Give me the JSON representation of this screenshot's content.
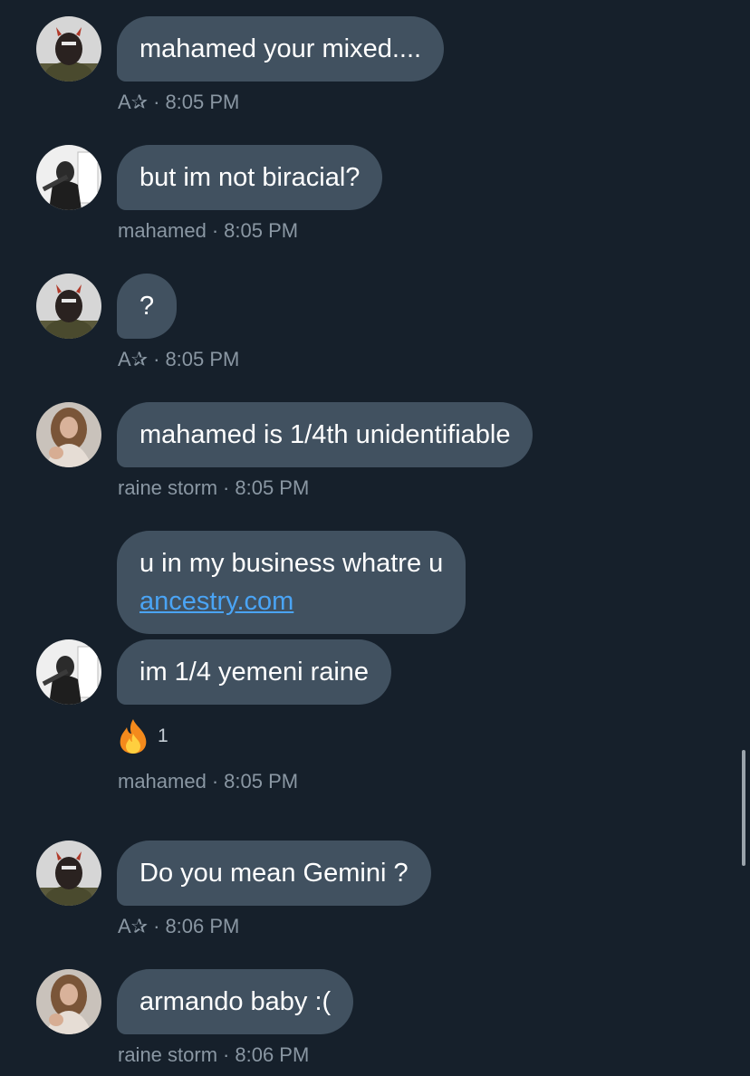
{
  "colors": {
    "background": "#16202b",
    "bubble": "#415160",
    "meta_text": "#8a97a3",
    "link": "#4aa4f5"
  },
  "messages": [
    {
      "author": "A✰",
      "time": "8:05 PM",
      "text": "mahamed your mixed....",
      "avatar": "avatar-a"
    },
    {
      "author": "mahamed",
      "time": "8:05 PM",
      "text": "but im not biracial?",
      "avatar": "avatar-mahamed"
    },
    {
      "author": "A✰",
      "time": "8:05 PM",
      "text": "?",
      "avatar": "avatar-a"
    },
    {
      "author": "raine storm",
      "time": "8:05 PM",
      "text": "mahamed is 1/4th unidentifiable",
      "avatar": "avatar-raine"
    },
    {
      "author": "mahamed",
      "time": "8:05 PM",
      "avatar": "avatar-mahamed",
      "bubbles": [
        {
          "text_line1": "u in my business whatre u",
          "link": "ancestry.com"
        },
        {
          "text": "im 1/4 yemeni raine"
        }
      ],
      "reaction": {
        "icon": "fire-emoji-icon",
        "count": "1"
      }
    },
    {
      "author": "A✰",
      "time": "8:06 PM",
      "text": "Do you mean Gemini ?",
      "avatar": "avatar-a"
    },
    {
      "author": "raine storm",
      "time": "8:06 PM",
      "text": "armando baby :(",
      "avatar": "avatar-raine"
    }
  ],
  "separator": "·"
}
